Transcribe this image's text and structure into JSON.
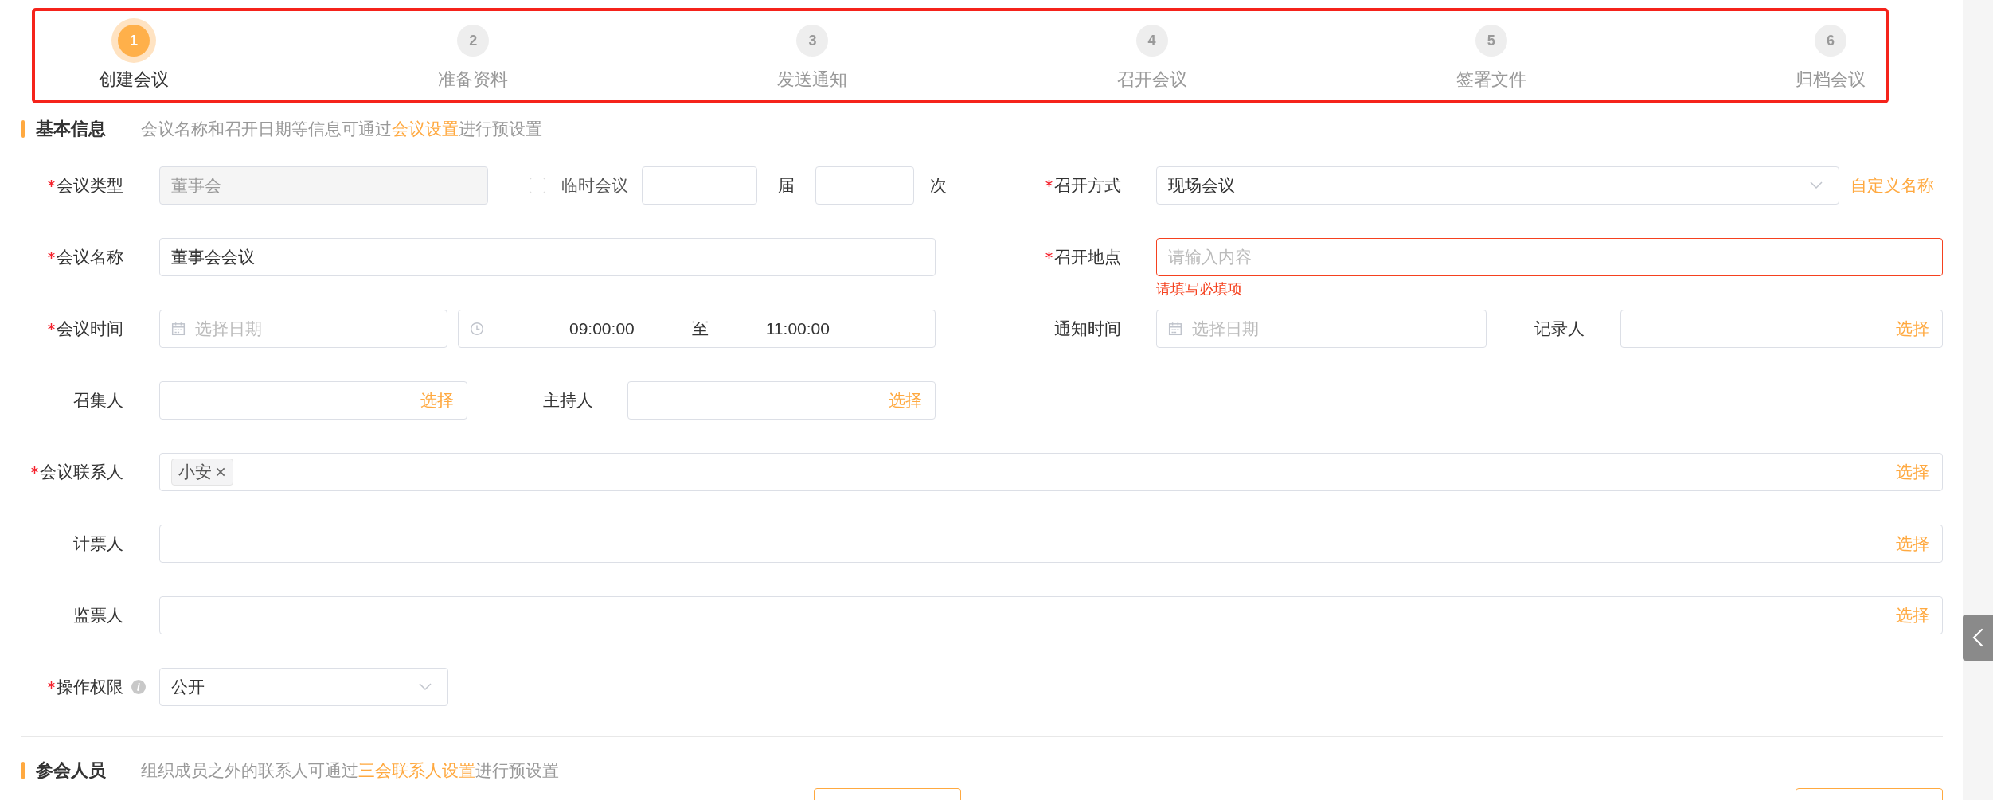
{
  "steps": [
    {
      "number": "1",
      "label": "创建会议",
      "selected": true
    },
    {
      "number": "2",
      "label": "准备资料",
      "selected": false
    },
    {
      "number": "3",
      "label": "发送通知",
      "selected": false
    },
    {
      "number": "4",
      "label": "召开会议",
      "selected": false
    },
    {
      "number": "5",
      "label": "签署文件",
      "selected": false
    },
    {
      "number": "6",
      "label": "归档会议",
      "selected": false
    }
  ],
  "basic_info": {
    "title": "基本信息",
    "hint": "会议名称和召开日期等信息可通过",
    "hint_link": "会议设置",
    "hint_end": "进行预设置"
  },
  "meeting_type": {
    "label": "会议类型",
    "required": true,
    "value": "董事会",
    "disabled": true
  },
  "temporary": {
    "label": "临时会议",
    "checked": false
  },
  "session": {
    "unit": "届"
  },
  "count": {
    "unit": "次"
  },
  "mode": {
    "label": "召开方式",
    "required": true,
    "value": "现场会议",
    "link": "自定义名称"
  },
  "name": {
    "label": "会议名称",
    "required": true,
    "value": "董事会会议"
  },
  "location": {
    "label": "召开地点",
    "required": true,
    "placeholder": "请输入内容",
    "error": "请填写必填项"
  },
  "time": {
    "label": "会议时间",
    "required": true,
    "date_placeholder": "选择日期",
    "start": "09:00:00",
    "separator": "至",
    "end": "11:00:00"
  },
  "notify_time": {
    "label": "通知时间",
    "placeholder": "选择日期"
  },
  "recorder": {
    "label": "记录人",
    "action": "选择"
  },
  "convener": {
    "label": "召集人",
    "action": "选择"
  },
  "host": {
    "label": "主持人",
    "action": "选择"
  },
  "contacts": {
    "label": "会议联系人",
    "required": true,
    "tags": [
      "小安"
    ],
    "action": "选择"
  },
  "teller": {
    "label": "计票人",
    "action": "选择"
  },
  "scrutineer": {
    "label": "监票人",
    "action": "选择"
  },
  "permission": {
    "label": "操作权限",
    "required": true,
    "value": "公开"
  },
  "attendees": {
    "title": "参会人员",
    "hint": "组织成员之外的联系人可通过",
    "hint_link": "三会联系人设置",
    "hint_end": "进行预设置"
  }
}
